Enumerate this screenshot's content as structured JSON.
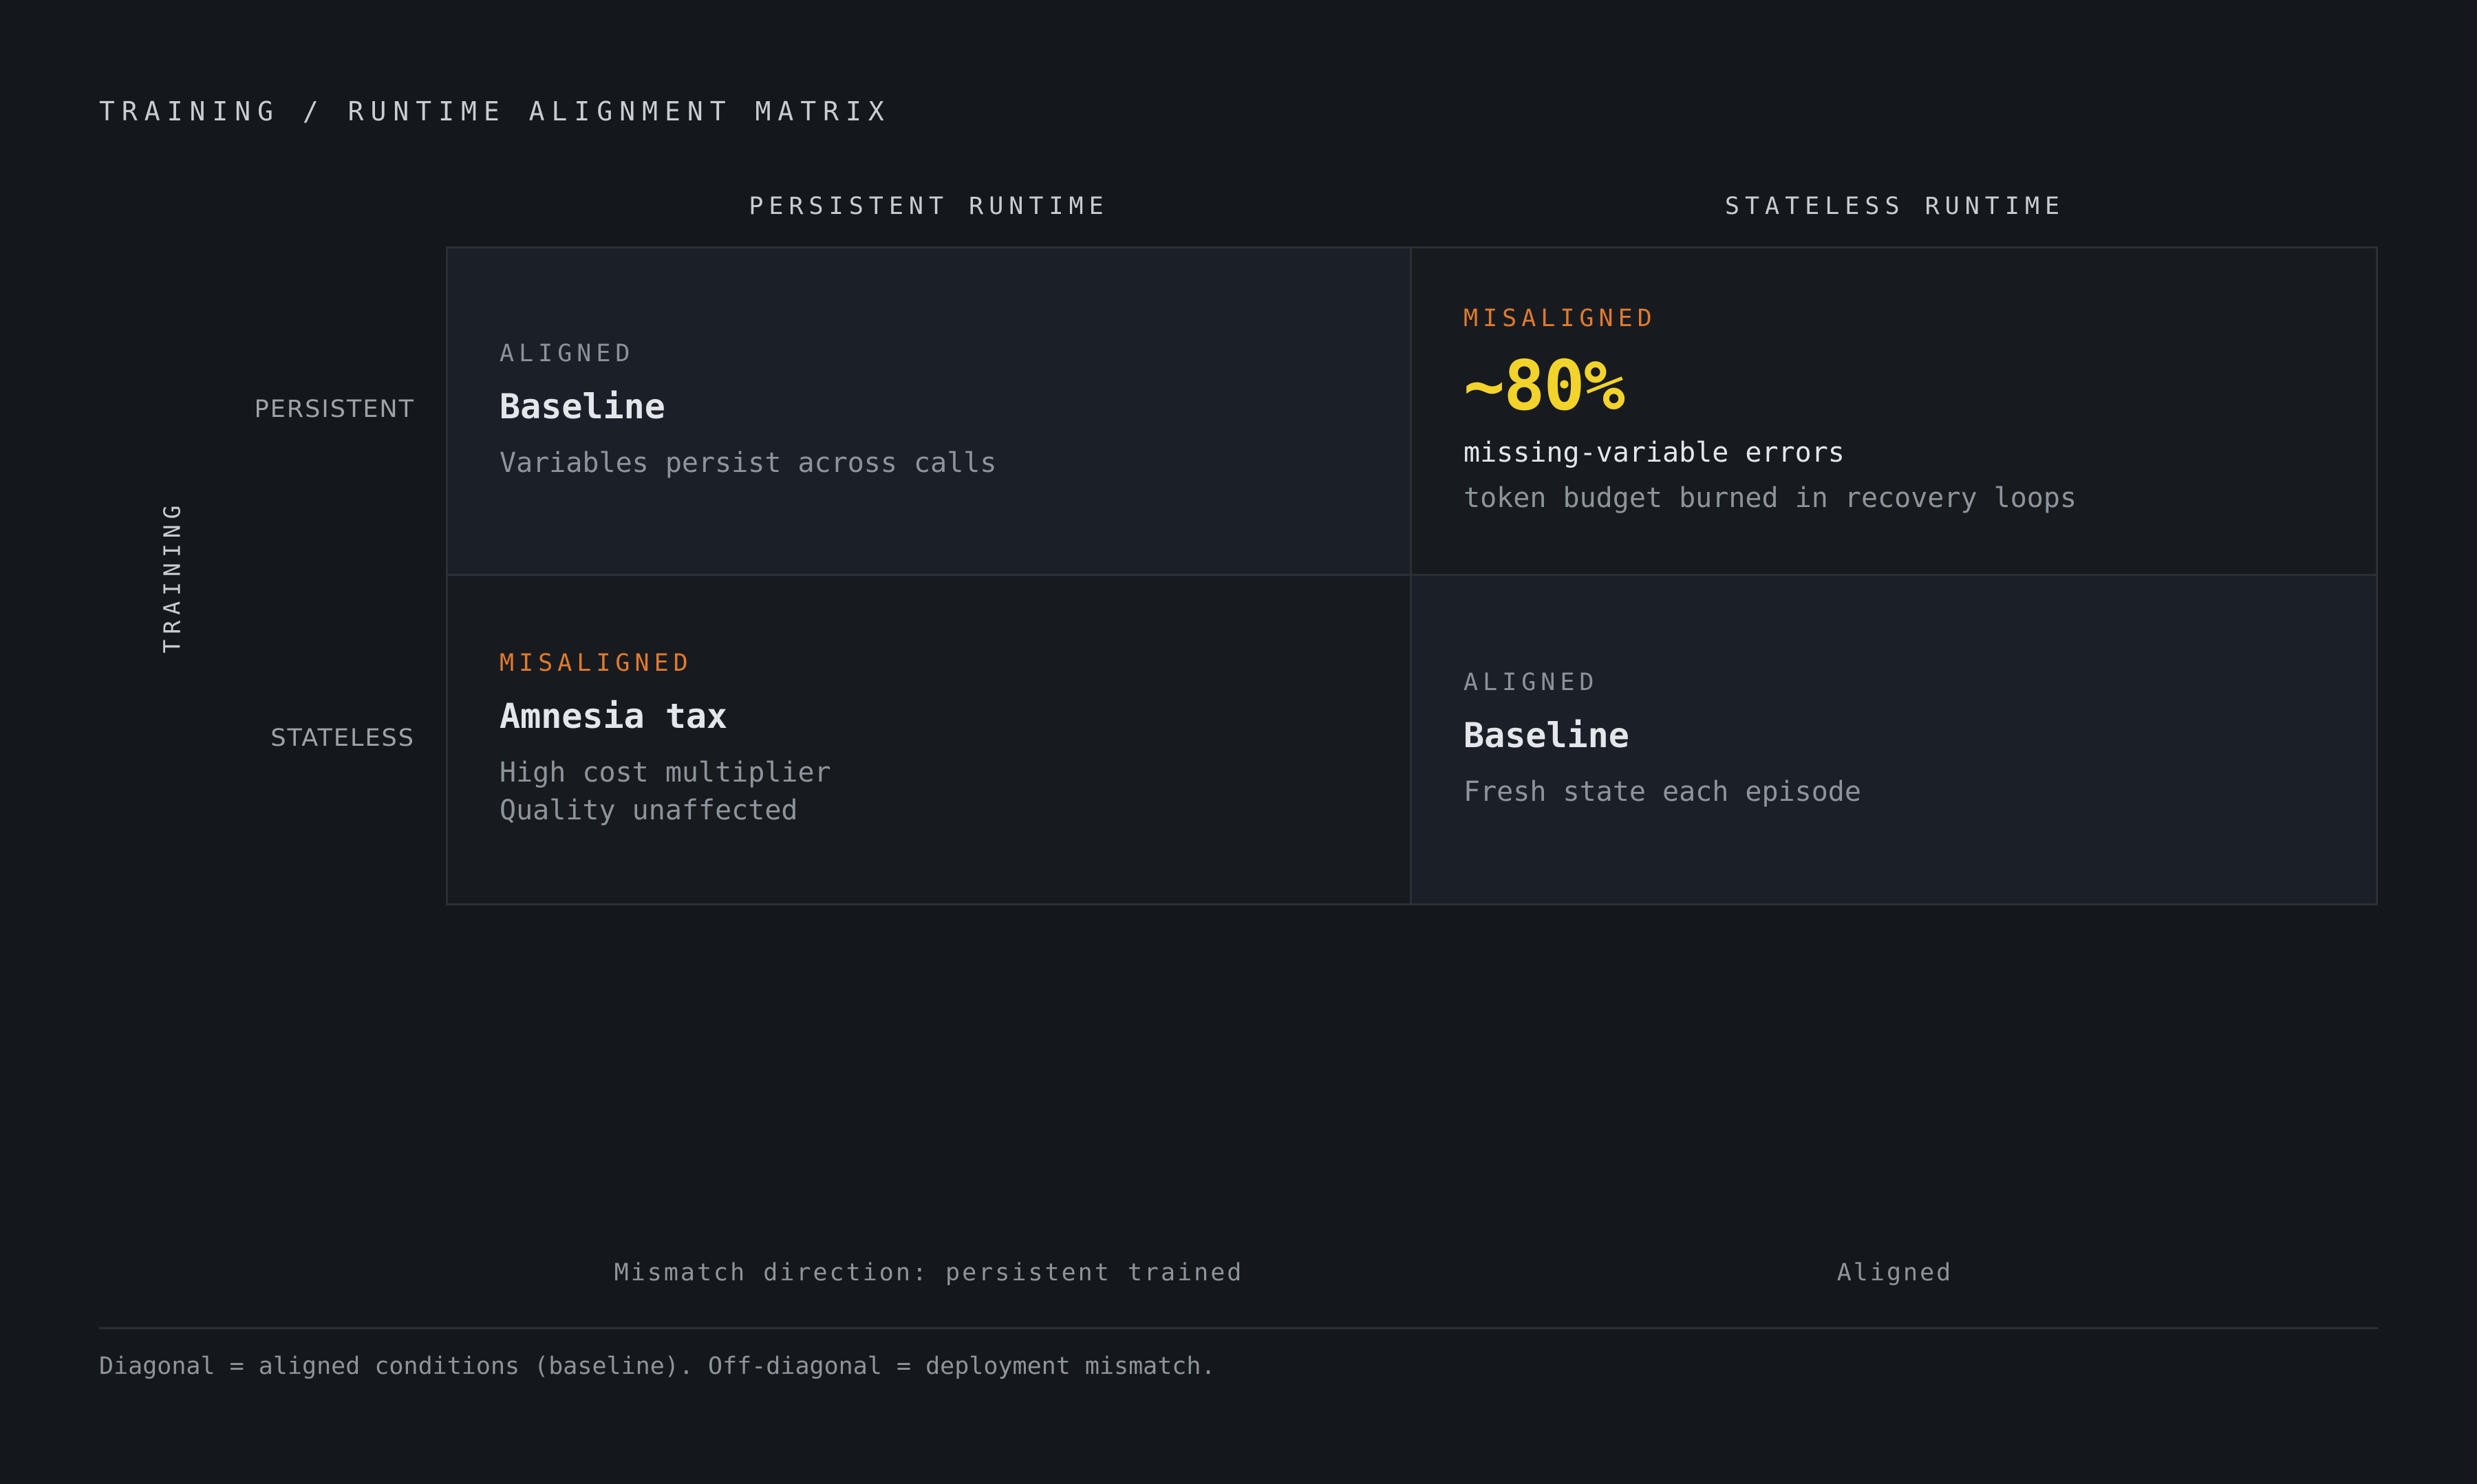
{
  "title": "TRAINING / RUNTIME ALIGNMENT MATRIX",
  "columns": [
    "PERSISTENT RUNTIME",
    "STATELESS RUNTIME"
  ],
  "row_axis_label": "TRAINING",
  "rows": [
    "PERSISTENT",
    "STATELESS"
  ],
  "colors": {
    "aligned_status": "#8c929a",
    "misaligned_status": "#e07a2e",
    "highlight_stat": "#f2d32b",
    "aligned_cell_bg": "#1b2028",
    "misaligned_cell_bg": "#171b20"
  },
  "cells": {
    "persistent_persistent": {
      "status": "ALIGNED",
      "title": "Baseline",
      "lines": [
        "Variables persist across calls"
      ]
    },
    "persistent_stateless": {
      "status": "MISALIGNED",
      "stat": "~80%",
      "stat_label": "missing-variable errors",
      "lines": [
        "token budget burned in recovery loops"
      ]
    },
    "stateless_persistent": {
      "status": "MISALIGNED",
      "title": "Amnesia tax",
      "lines": [
        "High cost multiplier",
        "Quality unaffected"
      ]
    },
    "stateless_stateless": {
      "status": "ALIGNED",
      "title": "Baseline",
      "lines": [
        "Fresh state each episode"
      ]
    }
  },
  "footer": {
    "captions": [
      "Mismatch direction: persistent trained",
      "Aligned"
    ],
    "note": "Diagonal = aligned conditions (baseline). Off-diagonal = deployment mismatch."
  }
}
